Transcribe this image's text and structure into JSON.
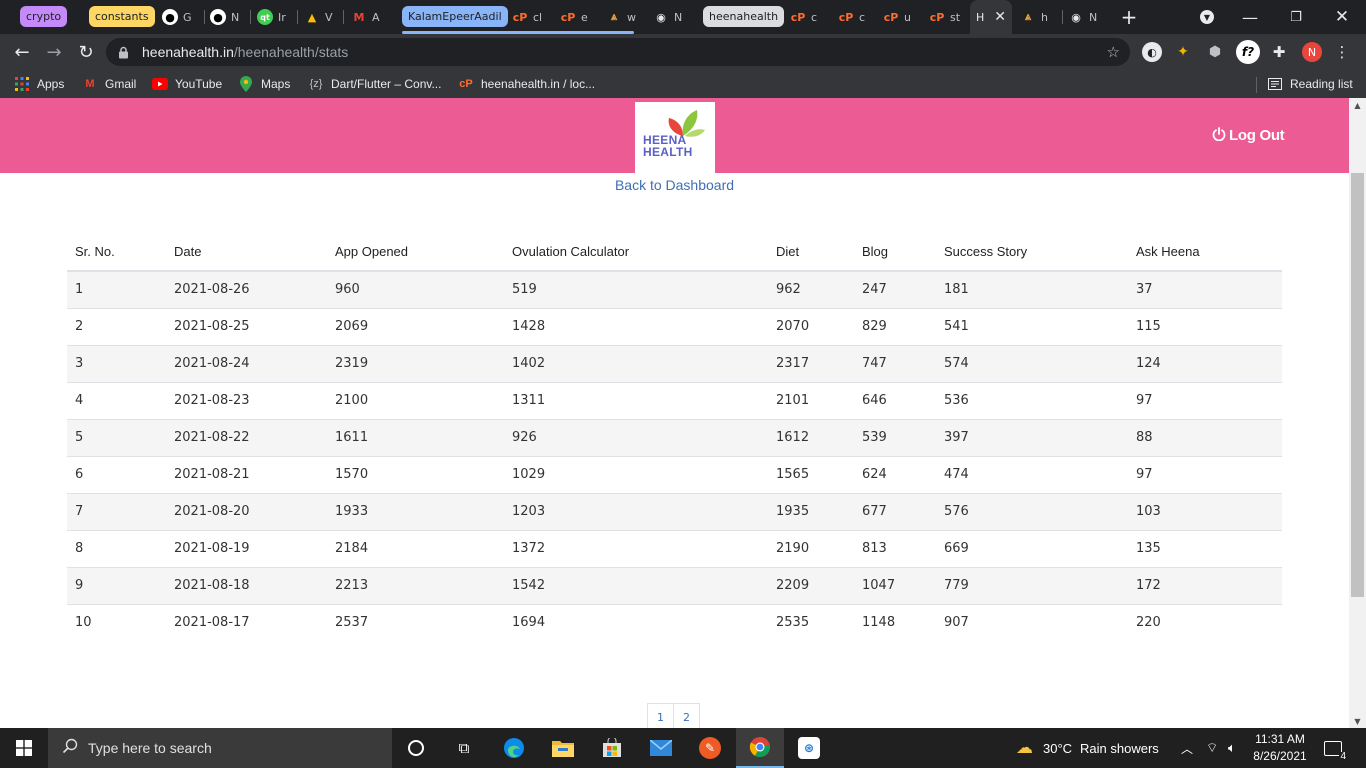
{
  "browser": {
    "tab_groups": [
      {
        "label": "crypto",
        "color": "#c58af9"
      },
      {
        "label": "constants",
        "color": "#fdd663"
      },
      {
        "label": "KalamEpeerAadil",
        "color": "#8ab4f8"
      },
      {
        "label": "heenahealth",
        "color": "#dadce0"
      }
    ],
    "tabs": [
      "G",
      "N",
      "Ir",
      "V",
      "A",
      "cl",
      "e",
      "w",
      "N",
      "c",
      "c",
      "u",
      "st",
      "H",
      "h",
      "N"
    ],
    "active_tab_label": "H",
    "new_tab_symbol": "+",
    "url_host": "heenahealth.in",
    "url_path": "/heenahealth/stats",
    "profile_initial": "N"
  },
  "bookmarks": [
    {
      "label": "Apps",
      "icon": "apps-grid-icon"
    },
    {
      "label": "Gmail",
      "icon": "gmail-icon"
    },
    {
      "label": "YouTube",
      "icon": "youtube-icon"
    },
    {
      "label": "Maps",
      "icon": "maps-icon"
    },
    {
      "label": "Dart/Flutter – Conv...",
      "icon": "dartpad-icon"
    },
    {
      "label": "heenahealth.in / loc...",
      "icon": "cpanel-icon"
    },
    {
      "label": "Reading list",
      "icon": "reading-list-icon"
    }
  ],
  "header": {
    "logo_line1": "HEENA",
    "logo_line2": "HEALTH",
    "logout_label": "Log Out",
    "brand_color": "#ec5b93"
  },
  "back_link": "Back to Dashboard",
  "table": {
    "columns": [
      "Sr. No.",
      "Date",
      "App Opened",
      "Ovulation Calculator",
      "Diet",
      "Blog",
      "Success Story",
      "Ask Heena"
    ],
    "rows": [
      [
        "1",
        "2021-08-26",
        "960",
        "519",
        "962",
        "247",
        "181",
        "37"
      ],
      [
        "2",
        "2021-08-25",
        "2069",
        "1428",
        "2070",
        "829",
        "541",
        "115"
      ],
      [
        "3",
        "2021-08-24",
        "2319",
        "1402",
        "2317",
        "747",
        "574",
        "124"
      ],
      [
        "4",
        "2021-08-23",
        "2100",
        "1311",
        "2101",
        "646",
        "536",
        "97"
      ],
      [
        "5",
        "2021-08-22",
        "1611",
        "926",
        "1612",
        "539",
        "397",
        "88"
      ],
      [
        "6",
        "2021-08-21",
        "1570",
        "1029",
        "1565",
        "624",
        "474",
        "97"
      ],
      [
        "7",
        "2021-08-20",
        "1933",
        "1203",
        "1935",
        "677",
        "576",
        "103"
      ],
      [
        "8",
        "2021-08-19",
        "2184",
        "1372",
        "2190",
        "813",
        "669",
        "135"
      ],
      [
        "9",
        "2021-08-18",
        "2213",
        "1542",
        "2209",
        "1047",
        "779",
        "172"
      ],
      [
        "10",
        "2021-08-17",
        "2537",
        "1694",
        "2535",
        "1148",
        "907",
        "220"
      ]
    ]
  },
  "pagination": [
    "1",
    "2"
  ],
  "taskbar": {
    "search_placeholder": "Type here to search",
    "weather_temp": "30°C",
    "weather_text": "Rain showers",
    "time": "11:31 AM",
    "date": "8/26/2021",
    "notification_count": "4"
  }
}
